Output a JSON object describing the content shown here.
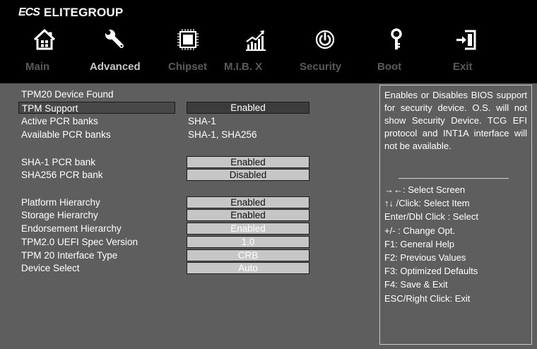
{
  "brand": {
    "logo": "ECS",
    "name": "ELITEGROUP"
  },
  "nav": {
    "tabs": [
      "Main",
      "Advanced",
      "Chipset",
      "M.I.B. X",
      "Security",
      "Boot",
      "Exit"
    ],
    "active": "Advanced"
  },
  "settings": [
    {
      "label": "TPM20 Device Found"
    },
    {
      "label": "TPM Support",
      "value": "Enabled",
      "kind": "option",
      "selected": true
    },
    {
      "label": "Active PCR banks",
      "value": "SHA-1",
      "kind": "text"
    },
    {
      "label": "Available PCR banks",
      "value": "SHA-1, SHA256",
      "kind": "text"
    },
    {
      "label": "SHA-1 PCR bank",
      "value": "Enabled",
      "kind": "option"
    },
    {
      "label": "SHA256 PCR bank",
      "value": "Disabled",
      "kind": "option"
    },
    {
      "label": "Platform Hierarchy",
      "value": "Enabled",
      "kind": "option"
    },
    {
      "label": "Storage Hierarchy",
      "value": "Enabled",
      "kind": "option"
    },
    {
      "label": "Endorsement Hierarchy",
      "value": "Enabled",
      "kind": "option",
      "locked": true
    },
    {
      "label": "TPM2.0 UEFI Spec Version",
      "value": "1.0",
      "kind": "option",
      "locked": true
    },
    {
      "label": "TPM 20 Interface Type",
      "value": "CRB",
      "kind": "option",
      "locked": true
    },
    {
      "label": "Device Select",
      "value": "Auto",
      "kind": "option",
      "locked": true
    }
  ],
  "help": {
    "description": "Enables or Disables BIOS support for security device. O.S. will not show Security Device. TCG EFI protocol and INT1A interface will not be available.",
    "keys": [
      "→←: Select Screen",
      "↑↓ /Click: Select Item",
      "Enter/Dbl Click : Select",
      "+/- : Change Opt.",
      "F1: General Help",
      "F2: Previous Values",
      "F3: Optimized Defaults",
      "F4: Save & Exit",
      "ESC/Right Click: Exit"
    ]
  },
  "colors": {
    "background": "#5e5e5e",
    "topbar": "#000000",
    "tab_active": "#c8c8c8",
    "tab_inactive": "#5a5a5a",
    "option_box": "#c6c6c6",
    "option_selected": "#3c3c3c"
  },
  "icons": [
    "home-icon",
    "wrench-icon",
    "chip-icon",
    "chart-icon",
    "power-icon",
    "key-icon",
    "exit-icon"
  ]
}
